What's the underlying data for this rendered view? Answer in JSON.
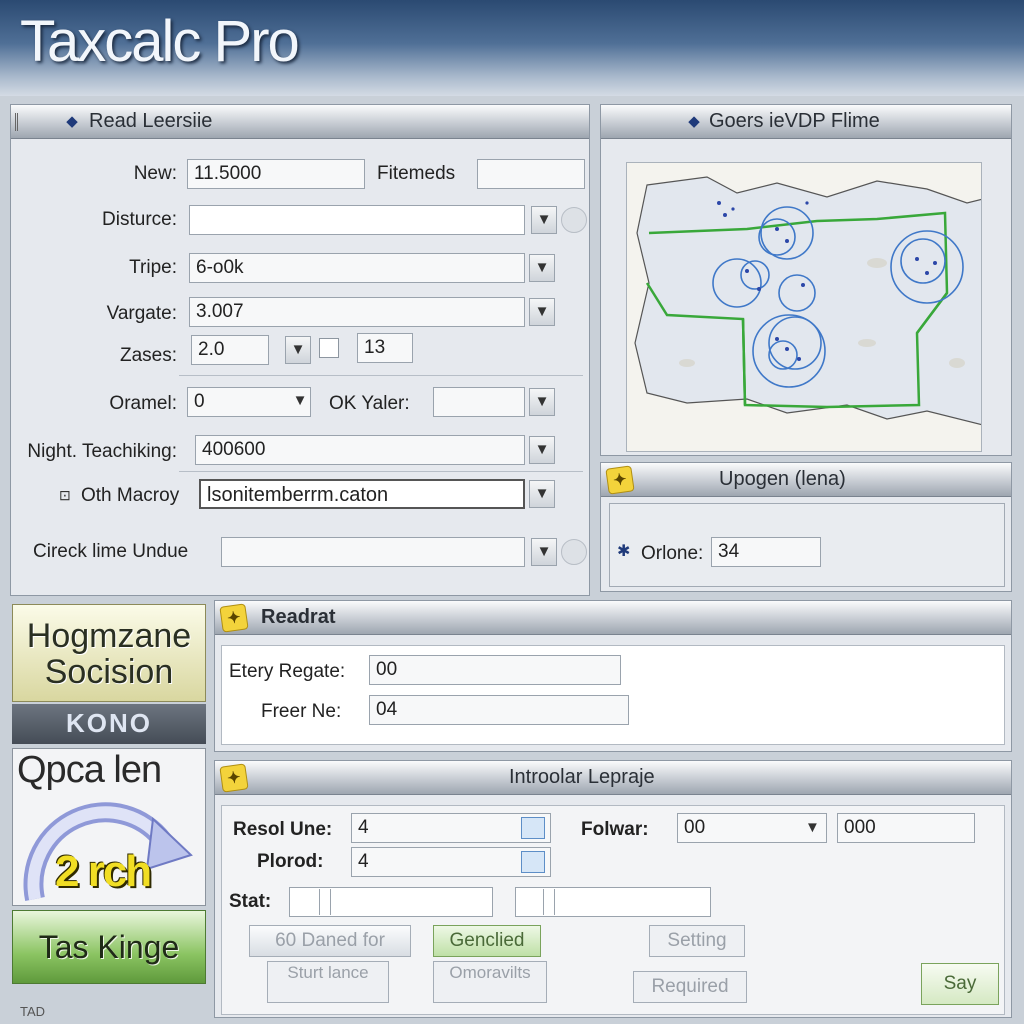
{
  "app": {
    "title": "Taxcalc Pro"
  },
  "read_panel": {
    "title": "Read Leersiie",
    "fields": {
      "new_label": "New:",
      "new_value": "11.5000",
      "fitemeds_label": "Fitemeds",
      "fitemeds_value": "",
      "disturce_label": "Disturce:",
      "disturce_value": "",
      "tripe_label": "Tripe:",
      "tripe_value": "6-o0k",
      "vargate_label": "Vargate:",
      "vargate_value": "3.007",
      "zases_label": "Zases:",
      "zases_value": "2.0",
      "zases_extra": "13",
      "oramel_label": "Oramel:",
      "oramel_value": "0",
      "ok_yaler_label": "OK Yaler:",
      "ok_yaler_value": "",
      "night_label": "Night. Teachiking:",
      "night_value": "400600",
      "oth_label": "Oth Macroy",
      "oth_value": "lsonitemberrm.caton",
      "check_label": "Cireck lime Undue",
      "check_value": ""
    }
  },
  "map_panel": {
    "title": "Goers ieVDP Flime"
  },
  "upgen_panel": {
    "title": "Upogen (lena)",
    "orlone_label": "Orlone:",
    "orlone_value": "34"
  },
  "sidebar": {
    "hogmzane_line1": "Hogmzane",
    "hogmzane_line2": "Socision",
    "kono": "KONO",
    "qpcalen": "Qpca len",
    "gauge_label": "2 rch",
    "tas_kinge": "Tas Kinge",
    "bottom_text": "TAD"
  },
  "readrat_panel": {
    "title": "Readrat",
    "eter_label": "Etery Regate:",
    "eter_value": "00",
    "freer_label": "Freer Ne:",
    "freer_value": "04"
  },
  "intro_panel": {
    "title": "Introolar Lepraje",
    "resol_label": "Resol Une:",
    "resol_value": "4",
    "folwar_label": "Folwar:",
    "folwar_value": "00",
    "folwar_value2": "000",
    "plorod_label": "Plorod:",
    "plorod_value": "4",
    "stat_label": "Stat:",
    "btn_60": "60 Daned for",
    "btn_gencllied": "Genclied",
    "btn_setting": "Setting",
    "btn_start": "Sturt lance",
    "btn_omoravilts": "Omoravilts",
    "btn_required": "Required",
    "btn_say": "Say"
  },
  "colors": {
    "accent_green": "#39a83a",
    "map_circle": "#3f78c8",
    "title_bg": "#2b4a72"
  }
}
